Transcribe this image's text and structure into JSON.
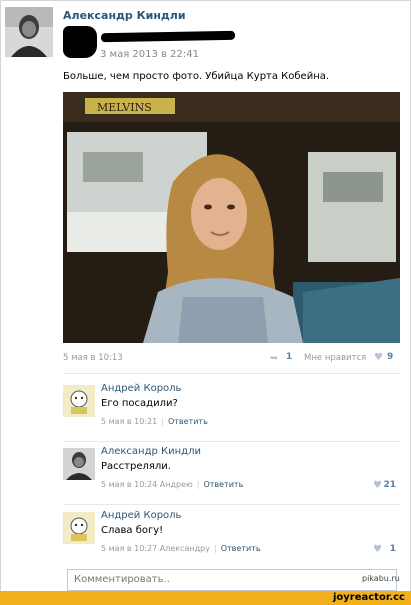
{
  "post": {
    "author": "Александр Киндли",
    "date": "3 мая 2013 в 22:41",
    "text": "Больше, чем просто фото. Убийца Курта Кобейна.",
    "photo_sign": "MELVINS"
  },
  "meta": {
    "time": "5 мая в 10:13",
    "share_count": "1",
    "like_label": "Мне нравится",
    "like_count": "9"
  },
  "comments": [
    {
      "author": "Андрей Король",
      "text": "Его посадили?",
      "meta": "5 мая в 10:21",
      "reply": "Ответить",
      "likes": ""
    },
    {
      "author": "Александр Киндли",
      "text": "Расстреляли.",
      "meta": "5 мая в 10:24 Андрею",
      "reply": "Ответить",
      "likes": "21"
    },
    {
      "author": "Андрей Король",
      "text": "Слава богу!",
      "meta": "5 мая в 10:27 Александру",
      "reply": "Ответить",
      "likes": "1"
    }
  ],
  "comment_input": {
    "placeholder": "Комментировать.."
  },
  "watermark": {
    "site": "pikabu.ru",
    "brand": "joyreactor.cc"
  },
  "colors": {
    "link": "#2b587a",
    "footer": "#f2b01c",
    "muted": "#999999"
  }
}
